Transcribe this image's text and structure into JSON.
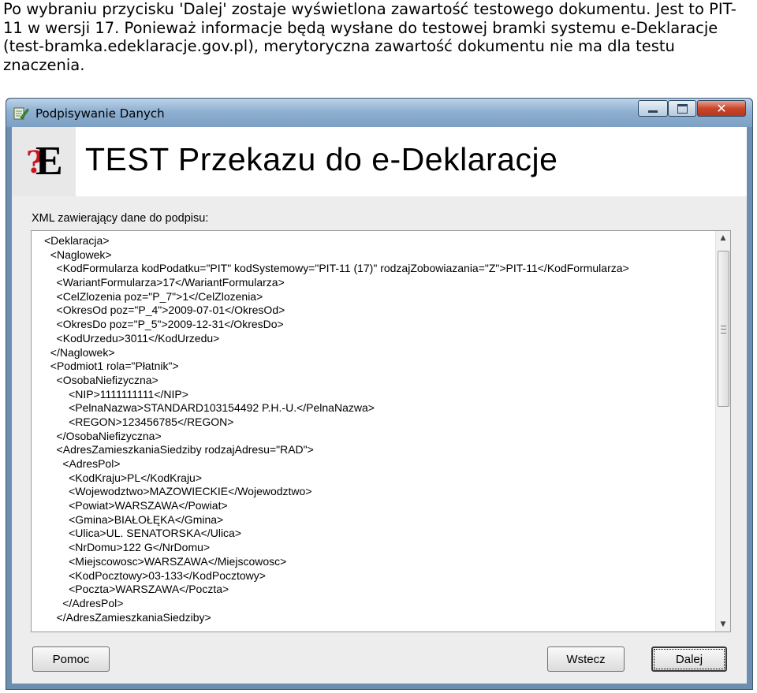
{
  "caption": {
    "text": "Po wybraniu przycisku 'Dalej' zostaje wyświetlona zawartość testowego dokumentu. Jest to PIT-11 w wersji 17. Ponieważ informacje będą wysłane do testowej bramki systemu e-Deklaracje (test-bramka.edeklaracje.gov.pl), merytoryczna zawartość dokumentu nie ma dla testu znaczenia."
  },
  "window": {
    "title": "Podpisywanie Danych",
    "close_glyph": "✕"
  },
  "banner": {
    "logo_q": "?",
    "logo_e": "E",
    "title": "TEST Przekazu do e-Deklaracje"
  },
  "xml": {
    "label": "XML zawierający dane do podpisu:",
    "lines": [
      "<Deklaracja>",
      "  <Naglowek>",
      "    <KodFormularza kodPodatku=\"PIT\" kodSystemowy=\"PIT-11 (17)\" rodzajZobowiazania=\"Z\">PIT-11</KodFormularza>",
      "    <WariantFormularza>17</WariantFormularza>",
      "    <CelZlozenia poz=\"P_7\">1</CelZlozenia>",
      "    <OkresOd poz=\"P_4\">2009-07-01</OkresOd>",
      "    <OkresDo poz=\"P_5\">2009-12-31</OkresDo>",
      "    <KodUrzedu>3011</KodUrzedu>",
      "  </Naglowek>",
      "  <Podmiot1 rola=\"Płatnik\">",
      "    <OsobaNiefizyczna>",
      "        <NIP>1111111111</NIP>",
      "        <PelnaNazwa>STANDARD103154492 P.H.-U.</PelnaNazwa>",
      "        <REGON>123456785</REGON>",
      "    </OsobaNiefizyczna>",
      "    <AdresZamieszkaniaSiedziby rodzajAdresu=\"RAD\">",
      "      <AdresPol>",
      "        <KodKraju>PL</KodKraju>",
      "        <Wojewodztwo>MAZOWIECKIE</Wojewodztwo>",
      "        <Powiat>WARSZAWA</Powiat>",
      "        <Gmina>BIAŁOŁĘKA</Gmina>",
      "        <Ulica>UL. SENATORSKA</Ulica>",
      "        <NrDomu>122 G</NrDomu>",
      "        <Miejscowosc>WARSZAWA</Miejscowosc>",
      "        <KodPocztowy>03-133</KodPocztowy>",
      "        <Poczta>WARSZAWA</Poczta>",
      "      </AdresPol>",
      "    </AdresZamieszkaniaSiedziby>"
    ]
  },
  "buttons": {
    "pomoc": "Pomoc",
    "wstecz": "Wstecz",
    "dalej": "Dalej"
  }
}
